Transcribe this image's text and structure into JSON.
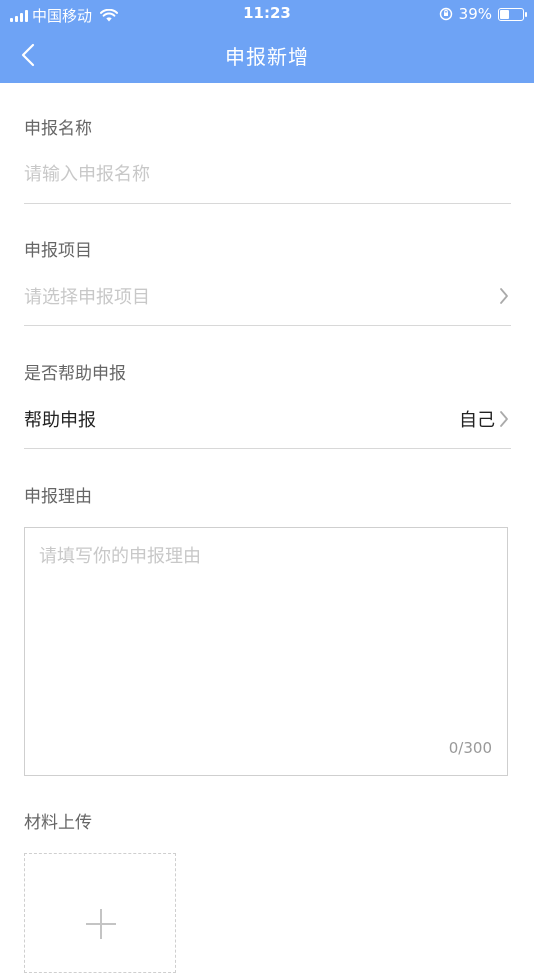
{
  "status_bar": {
    "carrier": "中国移动",
    "time": "11:23",
    "battery_percent": "39%",
    "battery_level": 0.39
  },
  "nav": {
    "title": "申报新增"
  },
  "form": {
    "name": {
      "label": "申报名称",
      "placeholder": "请输入申报名称",
      "value": ""
    },
    "project": {
      "label": "申报项目",
      "placeholder": "请选择申报项目"
    },
    "help": {
      "label": "是否帮助申报",
      "row_label": "帮助申报",
      "value": "自己"
    },
    "reason": {
      "label": "申报理由",
      "placeholder": "请填写你的申报理由",
      "counter": "0/300"
    },
    "upload": {
      "label": "材料上传"
    }
  },
  "colors": {
    "header_bg": "#6ea3f5",
    "placeholder": "#c8c8c8",
    "label": "#666666",
    "divider": "#d8d8d8"
  }
}
